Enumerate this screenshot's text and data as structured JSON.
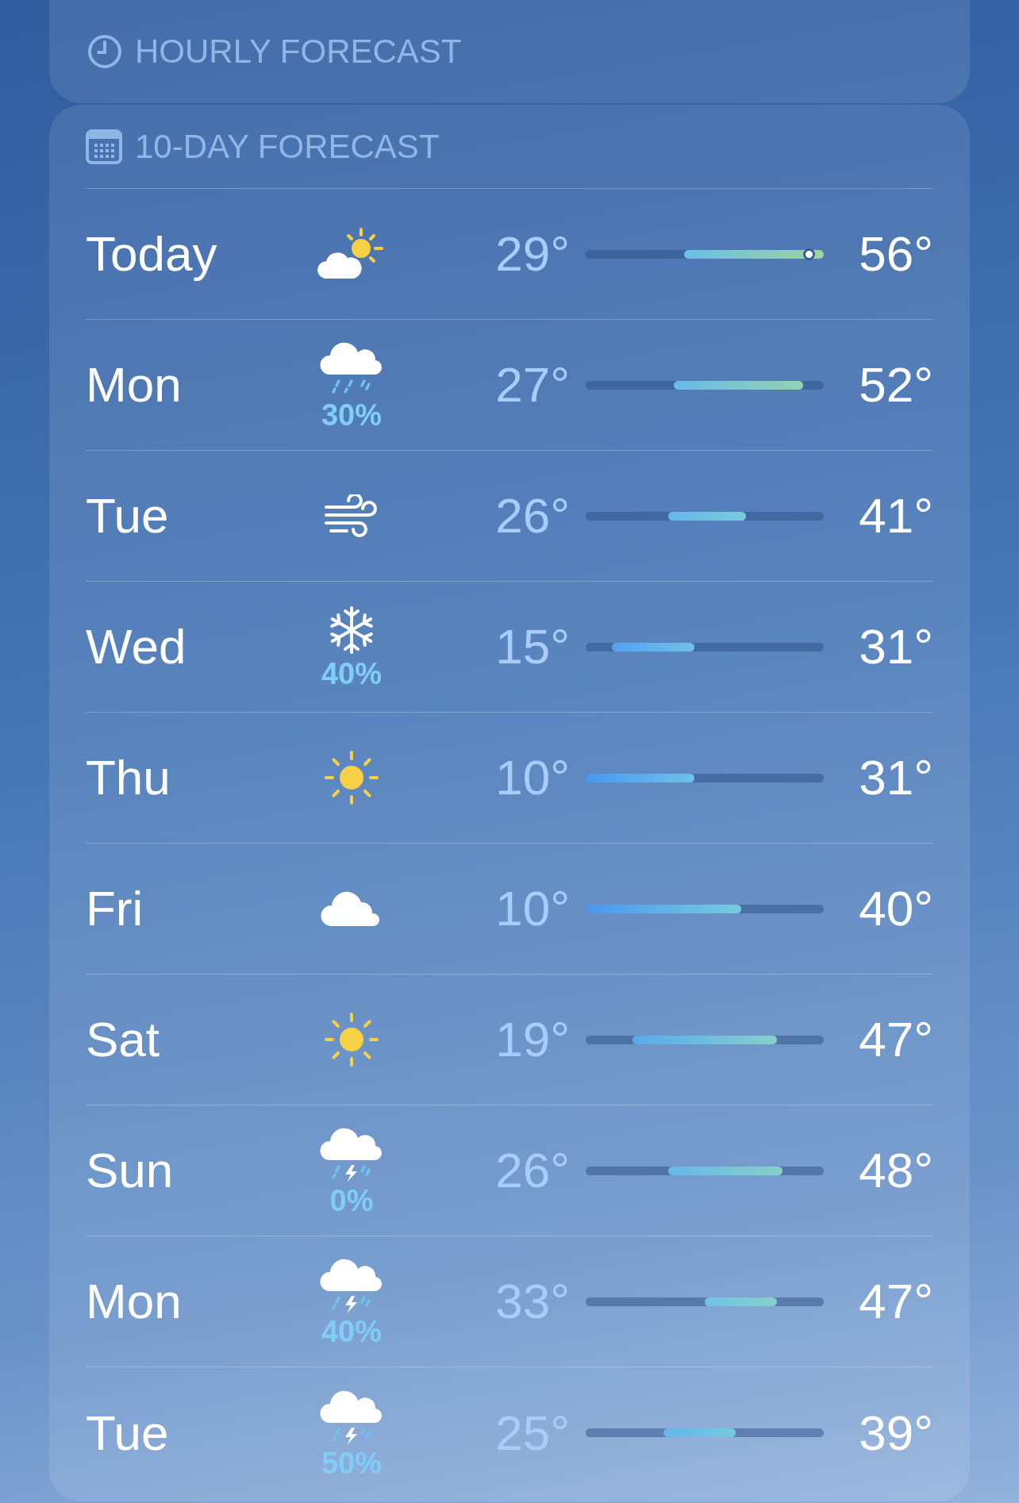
{
  "hourly_forecast": {
    "title": "HOURLY FORECAST"
  },
  "ten_day_forecast": {
    "title": "10-DAY FORECAST",
    "days": [
      {
        "day": "Today",
        "kind": "partly_sunny",
        "low": "29°",
        "high": "56°",
        "now_marker": true
      },
      {
        "day": "Mon",
        "kind": "rain",
        "precipitation": "30%",
        "low": "27°",
        "high": "52°",
        "now_marker": false
      },
      {
        "day": "Tue",
        "kind": "wind",
        "low": "26°",
        "high": "41°",
        "now_marker": false
      },
      {
        "day": "Wed",
        "kind": "snow",
        "precipitation": "40%",
        "low": "15°",
        "high": "31°",
        "now_marker": false
      },
      {
        "day": "Thu",
        "kind": "sun",
        "low": "10°",
        "high": "31°",
        "now_marker": false
      },
      {
        "day": "Fri",
        "kind": "cloud",
        "low": "10°",
        "high": "40°",
        "now_marker": false
      },
      {
        "day": "Sat",
        "kind": "sun",
        "low": "19°",
        "high": "47°",
        "now_marker": false
      },
      {
        "day": "Sun",
        "kind": "thunder",
        "precipitation": "0%",
        "low": "26°",
        "high": "48°",
        "now_marker": false
      },
      {
        "day": "Mon",
        "kind": "thunder",
        "precipitation": "40%",
        "low": "33°",
        "high": "47°",
        "now_marker": false
      },
      {
        "day": "Tue",
        "kind": "thunder",
        "precipitation": "50%",
        "low": "25°",
        "high": "39°",
        "now_marker": false
      }
    ]
  }
}
